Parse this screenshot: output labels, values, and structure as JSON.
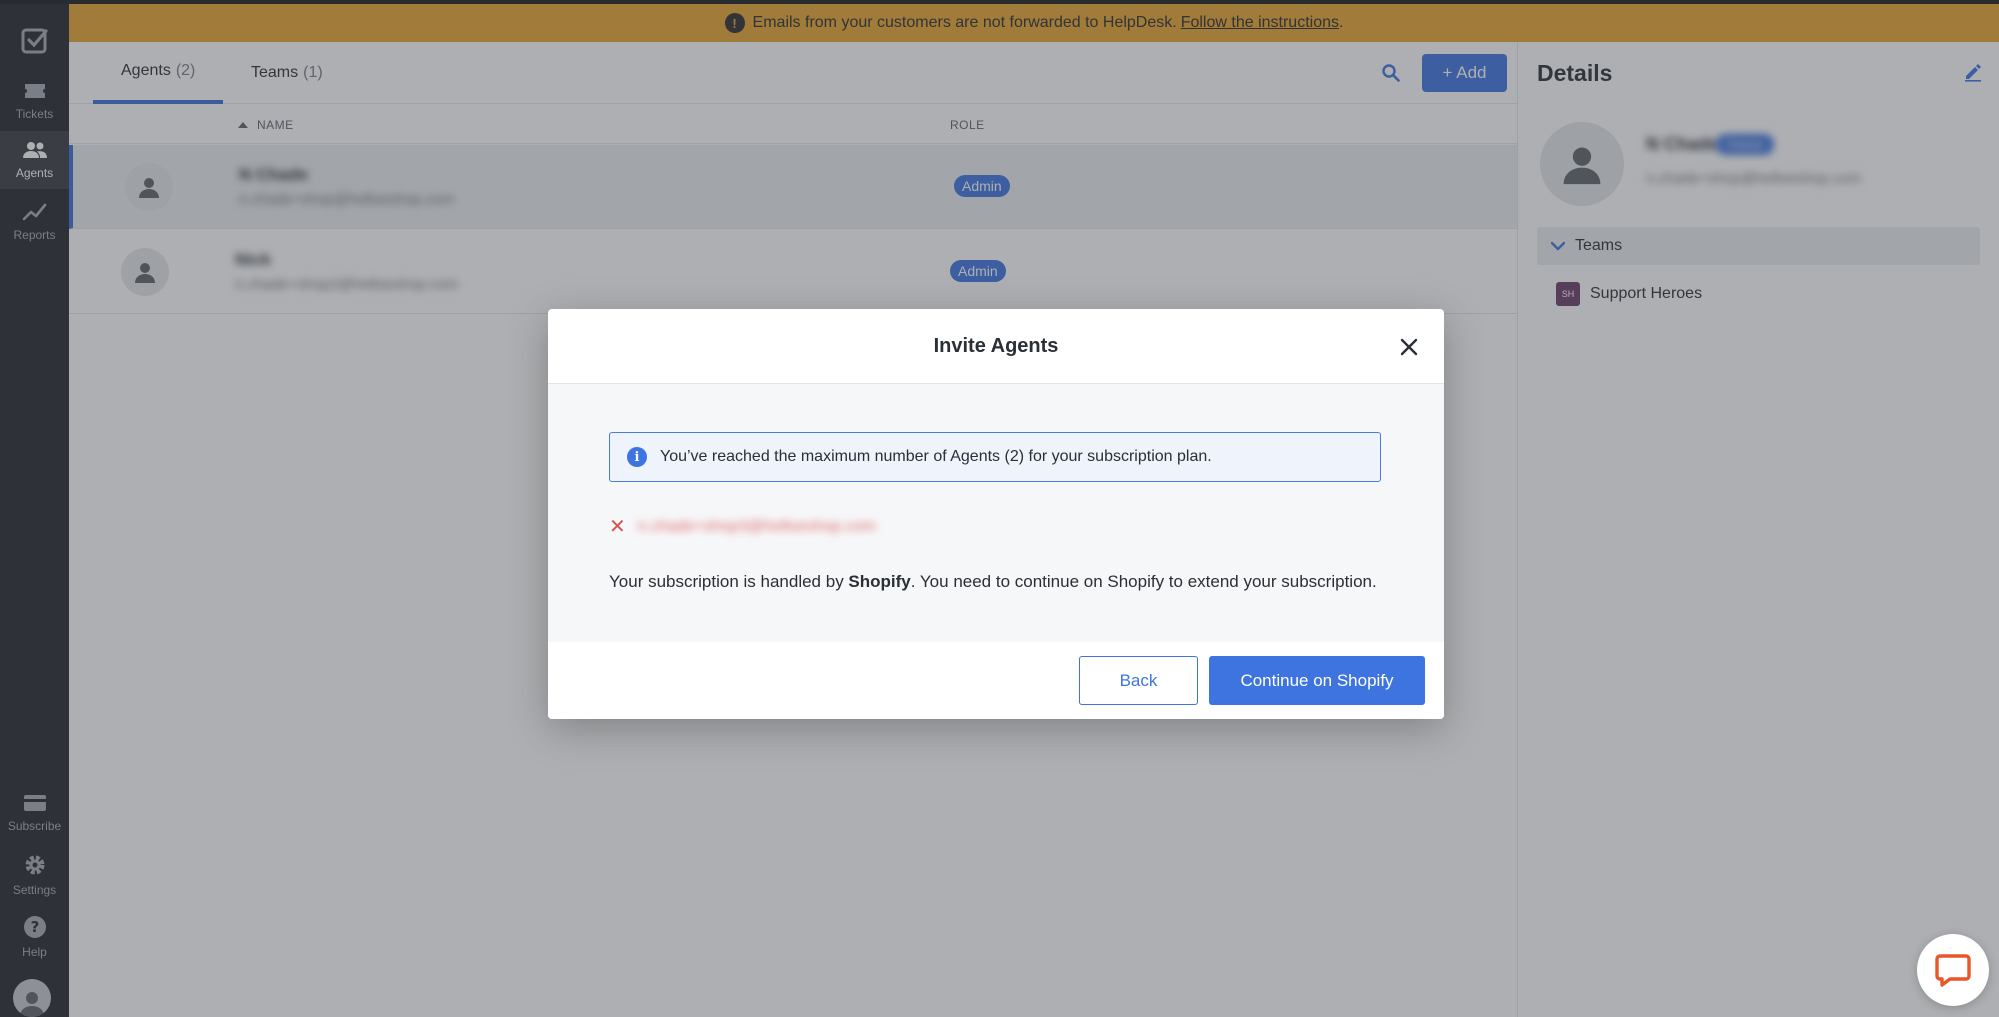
{
  "banner": {
    "text": "Emails from your customers are not forwarded to HelpDesk.",
    "link": "Follow the instructions",
    "suffix": "."
  },
  "sidebar": {
    "items": [
      {
        "label": "Tickets",
        "icon": "ticket-icon"
      },
      {
        "label": "Agents",
        "icon": "agents-icon",
        "active": true
      },
      {
        "label": "Reports",
        "icon": "chart-icon"
      },
      {
        "label": "Subscribe",
        "icon": "card-icon"
      },
      {
        "label": "Settings",
        "icon": "gear-icon"
      },
      {
        "label": "Help",
        "icon": "help-icon"
      }
    ]
  },
  "tabs": [
    {
      "label": "Agents",
      "count": "(2)",
      "active": true
    },
    {
      "label": "Teams",
      "count": "(1)"
    }
  ],
  "toolbar": {
    "add_label": "+ Add"
  },
  "table": {
    "headers": {
      "name": "NAME",
      "role": "ROLE"
    },
    "rows": [
      {
        "name": "N Chade",
        "email": "n.chade+shop@helloeshop.com",
        "role": "Admin",
        "selected": true
      },
      {
        "name": "Nick",
        "email": "n.chade+shop2@helloeshop.com",
        "role": "Admin"
      }
    ]
  },
  "details": {
    "title": "Details",
    "name": "N Chade",
    "status": "Owner",
    "email": "n.chade+shop@helloeshop.com",
    "teams_label": "Teams",
    "teams": [
      {
        "initials": "SH",
        "name": "Support Heroes"
      }
    ]
  },
  "modal": {
    "title": "Invite Agents",
    "info": "You’ve reached the maximum number of Agents (2) for your subscription plan.",
    "invalid_email": "n.chade+shop3@helloeshop.com",
    "sub_prefix": "Your subscription is handled by ",
    "sub_brand": "Shopify",
    "sub_suffix": ". You need to continue on Shopify to extend your subscription.",
    "back_label": "Back",
    "continue_label": "Continue on Shopify"
  },
  "colors": {
    "accent": "#3e74e0",
    "banner": "#e8a530",
    "sidebar": "#25272b",
    "error": "#d9534f"
  }
}
